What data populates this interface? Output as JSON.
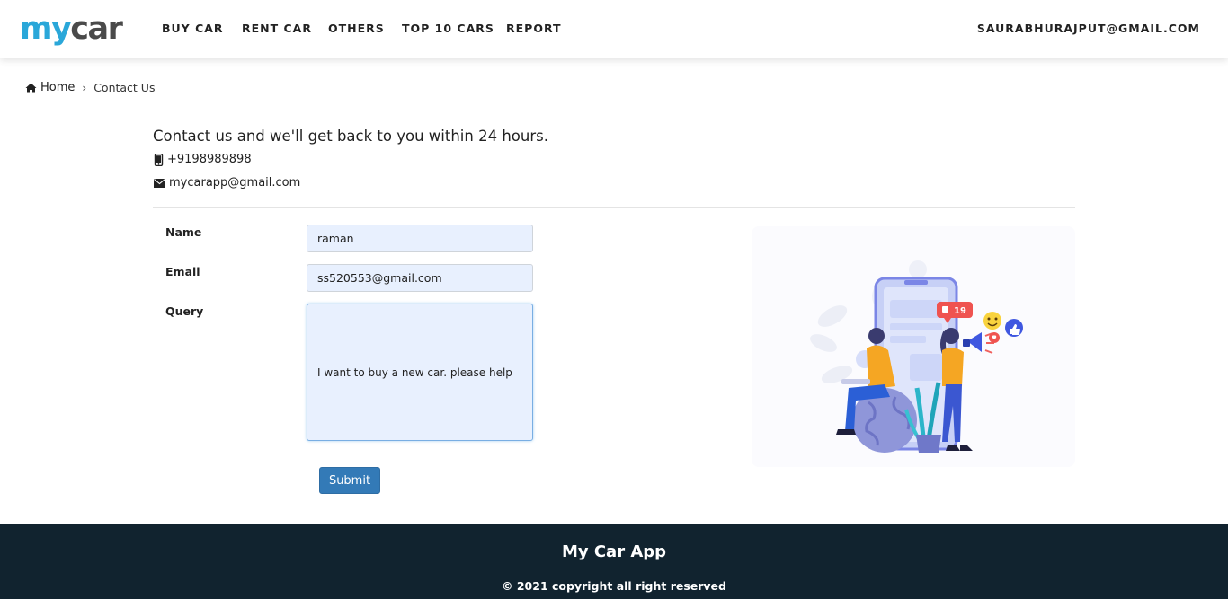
{
  "brand": {
    "part1": "my",
    "part2": "car"
  },
  "nav": {
    "items": [
      "BUY CAR",
      "RENT CAR",
      "OTHERS",
      "TOP 10 CARS",
      "REPORT"
    ],
    "user": "SAURABHURAJPUT@GMAIL.COM"
  },
  "breadcrumb": {
    "home": "Home",
    "current": "Contact Us"
  },
  "contact": {
    "heading": "Contact us and we'll get back to you within 24 hours.",
    "phone": "+9198989898",
    "email": "mycarapp@gmail.com"
  },
  "form": {
    "name_label": "Name",
    "name_value": "raman",
    "email_label": "Email",
    "email_value": "ss520553@gmail.com",
    "query_label": "Query",
    "query_value": "I want to buy a new car. please help",
    "submit_label": "Submit"
  },
  "illustration": {
    "like_count": "19"
  },
  "footer": {
    "title": "My Car App",
    "copyright": "© 2021 copyright all right reserved"
  },
  "colors": {
    "brand_blue": "#2aa7d9",
    "submit_blue": "#337ab7",
    "footer_bg": "#11232f",
    "input_bg": "#e8f0fe"
  }
}
